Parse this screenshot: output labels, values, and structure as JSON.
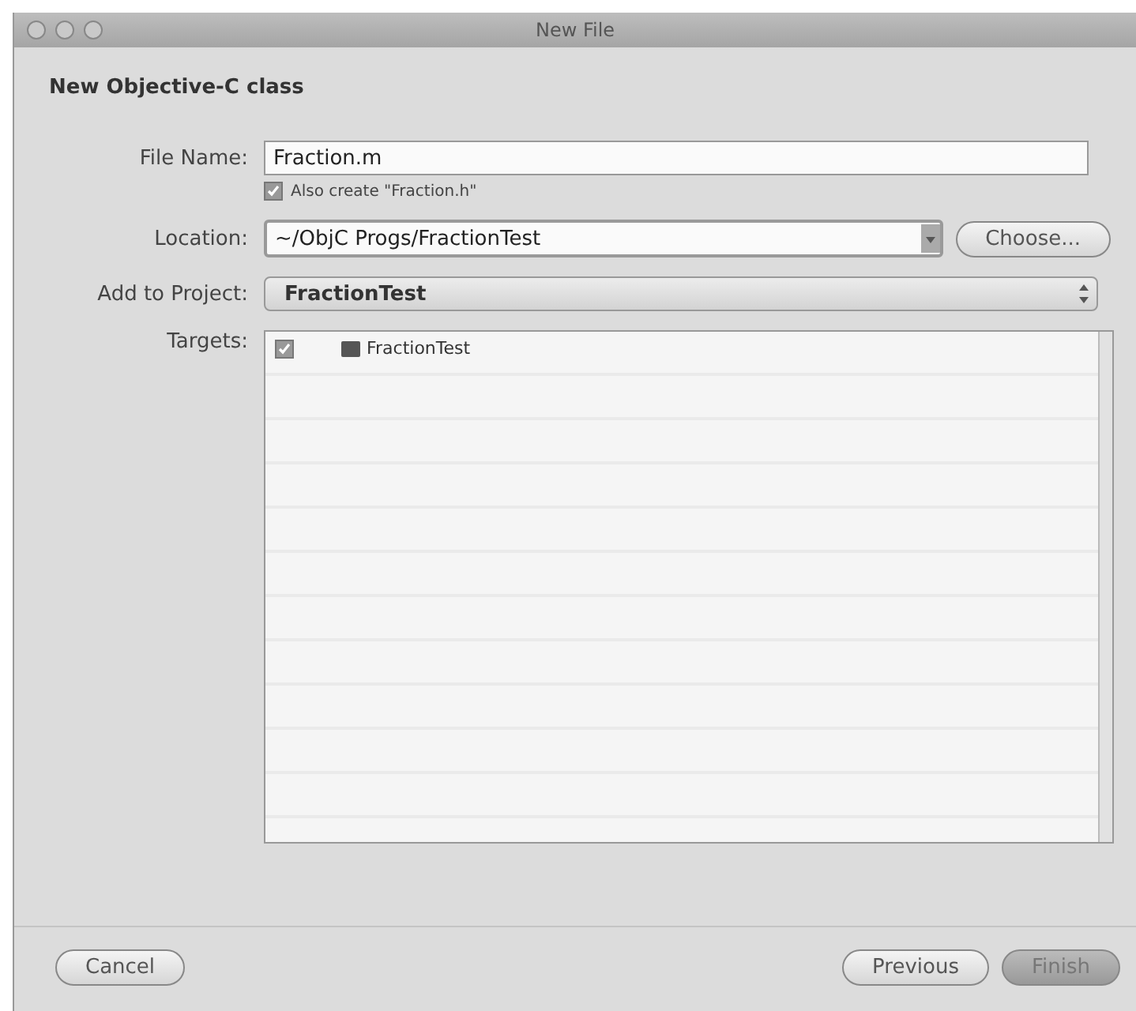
{
  "window": {
    "title": "New File"
  },
  "heading": "New Objective-C class",
  "file_name": {
    "label": "File Name:",
    "value": "Fraction.m"
  },
  "also_create": {
    "label": "Also create \"Fraction.h\"",
    "checked": true
  },
  "location": {
    "label": "Location:",
    "value": "~/ObjC Progs/FractionTest",
    "button": "Choose..."
  },
  "add_to_project": {
    "label": "Add to Project:",
    "value": "FractionTest"
  },
  "targets": {
    "label": "Targets:",
    "items": [
      {
        "name": "FractionTest",
        "checked": true
      }
    ]
  },
  "buttons": [
    {
      "label": "Cancel",
      "default": false
    },
    {
      "label": "Previous",
      "default": false
    },
    {
      "label": "Finish",
      "default": true
    }
  ]
}
